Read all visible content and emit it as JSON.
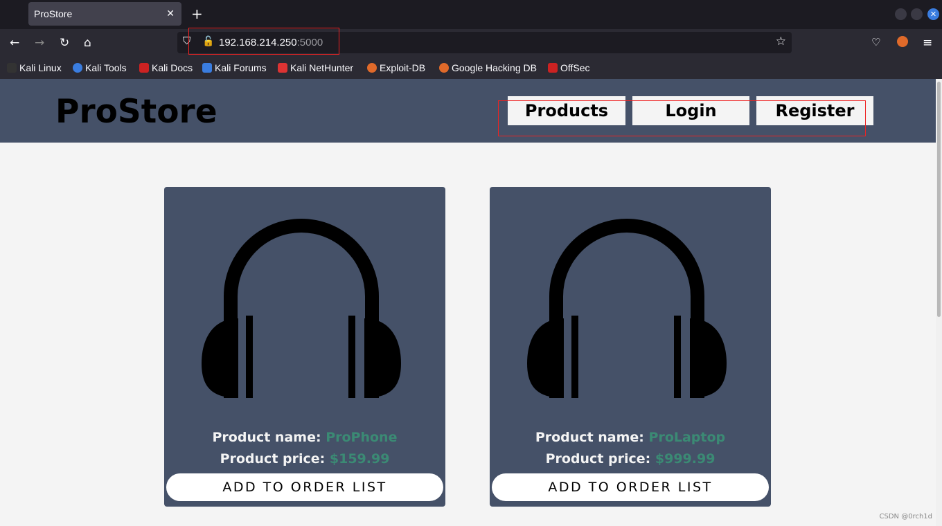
{
  "browser": {
    "tab_title": "ProStore",
    "url_host": "192.168.214.250",
    "url_port": ":5000",
    "bookmarks": [
      "Kali Linux",
      "Kali Tools",
      "Kali Docs",
      "Kali Forums",
      "Kali NetHunter",
      "Exploit-DB",
      "Google Hacking DB",
      "OffSec"
    ]
  },
  "site": {
    "logo": "ProStore",
    "nav": [
      "Products",
      "Login",
      "Register"
    ]
  },
  "products": [
    {
      "name_label": "Product name:",
      "name": "ProPhone",
      "price_label": "Product price:",
      "price": "$159.99",
      "button": "ADD TO ORDER LIST",
      "icon": "headphones-icon"
    },
    {
      "name_label": "Product name:",
      "name": "ProLaptop",
      "price_label": "Product price:",
      "price": "$999.99",
      "button": "ADD TO ORDER LIST",
      "icon": "headphones-icon"
    }
  ],
  "watermark": "CSDN @0rch1d",
  "colors": {
    "header": "#455168",
    "accent": "#3b8a74",
    "annotation": "#ee2222"
  }
}
